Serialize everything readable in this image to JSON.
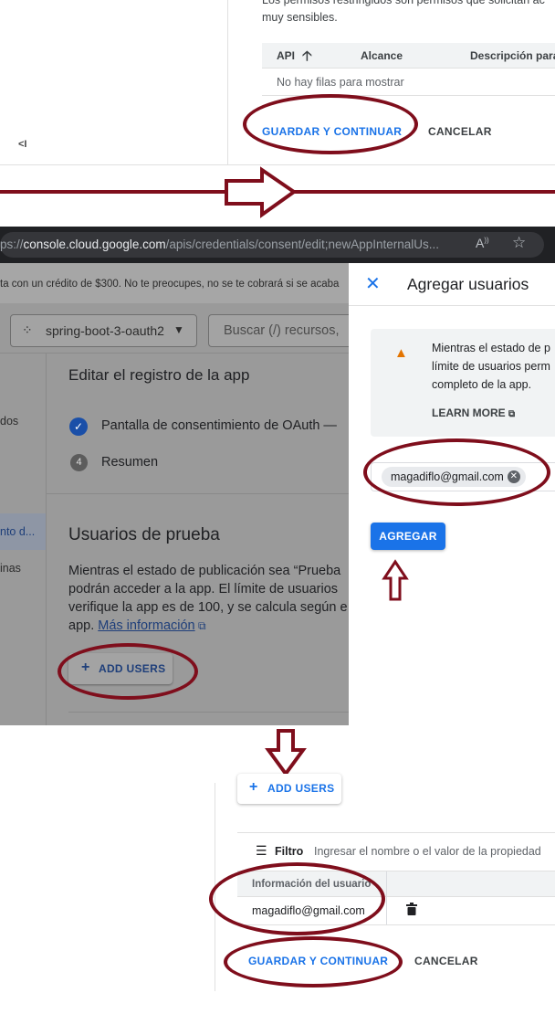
{
  "panel1": {
    "desc_line1": "Los permisos restringidos son permisos que solicitan ac",
    "desc_line2": "muy sensibles.",
    "table_headers": [
      "API",
      "Alcance",
      "Descripción para"
    ],
    "sort_icon": "arrow-up-icon",
    "empty_text": "No hay filas para mostrar",
    "save_label": "GUARDAR Y CONTINUAR",
    "cancel_label": "CANCELAR",
    "collapse_label": "<I"
  },
  "panel2": {
    "url_prefix": "ps://",
    "url_host": "console.cloud.google.com",
    "url_path": "/apis/credentials/consent/edit;newAppInternalUs...",
    "banner_text": "ta con un crédito de $300. No te preocupes, no se te cobrará si se acaba",
    "project_name": "spring-boot-3-oauth2",
    "search_placeholder": "Buscar (/) recursos,",
    "sidebar": [
      "dos",
      "nto d...",
      "inas"
    ],
    "edit_title": "Editar el registro de la app",
    "steps": [
      {
        "icon": "✓",
        "label": "Pantalla de consentimiento de OAuth —"
      },
      {
        "icon": "4",
        "label": "Resumen"
      }
    ],
    "test_title": "Usuarios de prueba",
    "test_text": "Mientras el estado de publicación sea “Prueba podrán acceder a la app. El límite de usuarios verifique la app es de 100, y se calcula según e app. ",
    "test_link": "Más información",
    "add_users_label": "ADD USERS"
  },
  "dialog": {
    "title": "Agregar usuarios",
    "warning_text": "Mientras el estado de p límite de usuarios perm completo de la app.",
    "learn_more": "LEARN MORE",
    "chip_email": "magadiflo@gmail.com",
    "add_label": "AGREGAR"
  },
  "panel3": {
    "add_users_label": "ADD USERS",
    "filter_label": "Filtro",
    "filter_placeholder": "Ingresar el nombre o el valor de la propiedad",
    "column_header": "Información del usuario",
    "user_email": "magadiflo@gmail.com",
    "save_label": "GUARDAR Y CONTINUAR",
    "cancel_label": "CANCELAR"
  },
  "colors": {
    "annotation": "#7f0e1c",
    "primary": "#1a73e8",
    "warning": "#e37400"
  }
}
